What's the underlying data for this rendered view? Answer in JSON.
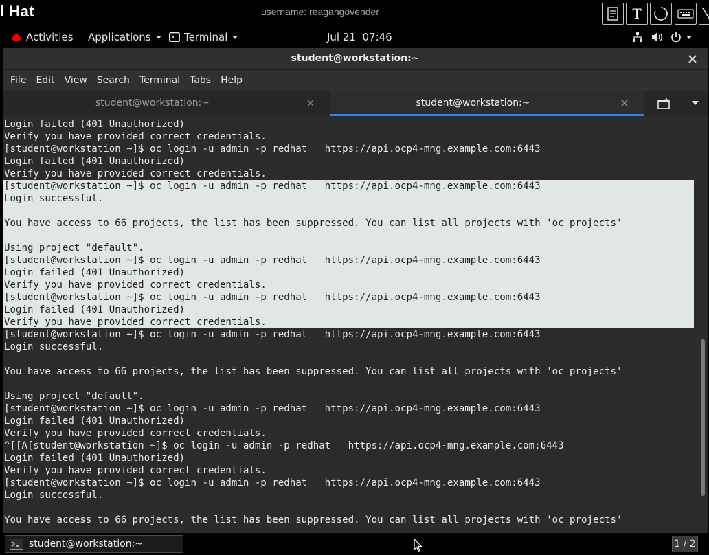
{
  "brand": {
    "logo_text": "l Hat",
    "username": "username: reagangovender"
  },
  "toolbar_buttons": [
    {
      "name": "notes-icon"
    },
    {
      "name": "text-icon",
      "label": "T"
    },
    {
      "name": "circle-icon"
    },
    {
      "name": "keyboard-icon"
    }
  ],
  "panel": {
    "activities": "Activities",
    "applications": "Applications",
    "terminal": "Terminal",
    "clock": "Jul 21  07:46"
  },
  "window": {
    "title": "student@workstation:~"
  },
  "menubar": [
    "File",
    "Edit",
    "View",
    "Search",
    "Terminal",
    "Tabs",
    "Help"
  ],
  "tabs": [
    {
      "label": "student@workstation:~",
      "active": false
    },
    {
      "label": "student@workstation:~",
      "active": true
    }
  ],
  "terminal": {
    "lines": [
      {
        "text": "Login failed (401 Unauthorized)",
        "selected": false
      },
      {
        "text": "Verify you have provided correct credentials.",
        "selected": false
      },
      {
        "text": "[student@workstation ~]$ oc login -u admin -p redhat   https://api.ocp4-mng.example.com:6443",
        "selected": false
      },
      {
        "text": "Login failed (401 Unauthorized)",
        "selected": false
      },
      {
        "text": "Verify you have provided correct credentials.",
        "selected": false
      },
      {
        "text": "[student@workstation ~]$ oc login -u admin -p redhat   https://api.ocp4-mng.example.com:6443",
        "selected": true
      },
      {
        "text": "Login successful.",
        "selected": true
      },
      {
        "text": "",
        "selected": true
      },
      {
        "text": "You have access to 66 projects, the list has been suppressed. You can list all projects with 'oc projects'",
        "selected": true
      },
      {
        "text": "",
        "selected": true
      },
      {
        "text": "Using project \"default\".",
        "selected": true
      },
      {
        "text": "[student@workstation ~]$ oc login -u admin -p redhat   https://api.ocp4-mng.example.com:6443",
        "selected": true
      },
      {
        "text": "Login failed (401 Unauthorized)",
        "selected": true
      },
      {
        "text": "Verify you have provided correct credentials.",
        "selected": true
      },
      {
        "text": "[student@workstation ~]$ oc login -u admin -p redhat   https://api.ocp4-mng.example.com:6443",
        "selected": true
      },
      {
        "text": "Login failed (401 Unauthorized)",
        "selected": true
      },
      {
        "text": "Verify you have provided correct credentials.",
        "selected": true
      },
      {
        "text": "[student@workstation ~]$ oc login -u admin -p redhat   https://api.ocp4-mng.example.com:6443",
        "selected": false
      },
      {
        "text": "Login successful.",
        "selected": false
      },
      {
        "text": "",
        "selected": false
      },
      {
        "text": "You have access to 66 projects, the list has been suppressed. You can list all projects with 'oc projects'",
        "selected": false
      },
      {
        "text": "",
        "selected": false
      },
      {
        "text": "Using project \"default\".",
        "selected": false
      },
      {
        "text": "[student@workstation ~]$ oc login -u admin -p redhat   https://api.ocp4-mng.example.com:6443",
        "selected": false
      },
      {
        "text": "Login failed (401 Unauthorized)",
        "selected": false
      },
      {
        "text": "Verify you have provided correct credentials.",
        "selected": false
      },
      {
        "text": "^[[A[student@workstation ~]$ oc login -u admin -p redhat   https://api.ocp4-mng.example.com:6443",
        "selected": false
      },
      {
        "text": "Login failed (401 Unauthorized)",
        "selected": false
      },
      {
        "text": "Verify you have provided correct credentials.",
        "selected": false
      },
      {
        "text": "[student@workstation ~]$ oc login -u admin -p redhat   https://api.ocp4-mng.example.com:6443",
        "selected": false
      },
      {
        "text": "Login successful.",
        "selected": false
      },
      {
        "text": "",
        "selected": false
      },
      {
        "text": "You have access to 66 projects, the list has been suppressed. You can list all projects with 'oc projects'",
        "selected": false
      }
    ]
  },
  "taskbar": {
    "item_label": "student@workstation:~",
    "workspace": "1 / 2"
  },
  "colors": {
    "selection_bg": "#e3e7e3",
    "tab_accent": "#3584e4",
    "terminal_bg": "#2b2b2b",
    "logo_red": "#ee0000"
  }
}
